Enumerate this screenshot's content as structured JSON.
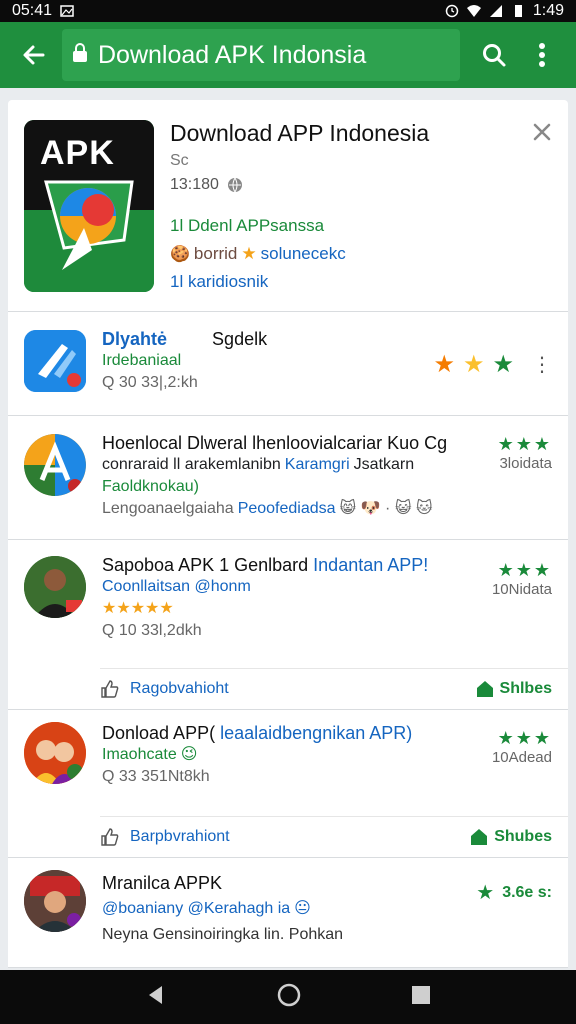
{
  "status_bar": {
    "time_left": "05:41",
    "time_right": "1:49"
  },
  "app_bar": {
    "url_text": "Download APK Indonsia"
  },
  "top_card": {
    "icon_text": "APK",
    "title": "Download APP Indonesia",
    "subtitle": "Sc",
    "meta": "13:180",
    "line1": "1l  Ddenl APPsanssa",
    "line2_a": "borrid",
    "line2_b": "solunecekc",
    "line3": "1l  karidiosnik"
  },
  "items": [
    {
      "title_a": "Dlyahtė",
      "title_b": "Sgdelk",
      "line1": "Irdebaniaal",
      "meta": "Q 30  33|,2:kh",
      "stars": [
        "orange",
        "gold",
        "green"
      ]
    },
    {
      "title": "Hoenlocal Dlweral lhenloovialcariar Kuo Cg",
      "line1_a": "conraraid ll arakemlanibn",
      "line1_b": "Karamgri",
      "line1_c": "Jsatkarn",
      "line2": "Faoldknokau)",
      "line3": "Lengoanaelgaiaha",
      "line3_b": "Peoofediadsa",
      "stars": "★★★",
      "count": "3loidata",
      "emoji": "😸 🐶 · 😺 🐱"
    },
    {
      "title_a": "Sapoboa APK  1 Genlbard",
      "title_b": "Indantan APP!",
      "line1": "Coonllaitsan @honm",
      "line2": "★★★★★",
      "meta": "Q 10  33l,2dkh",
      "stars": "★★★",
      "count": "10Nidata",
      "action_left": "Ragobvahioht",
      "action_right": "Shlbes"
    },
    {
      "title_a": "Donload APP(",
      "title_b": "leaalaidbengnikan APR)",
      "line1": "Imaohcate",
      "meta": "Q 33  351Nt8kh",
      "stars": "★★★",
      "count": "10Adead",
      "action_left": "Barpbvrahiont",
      "action_right": "Shubes"
    },
    {
      "title": "Mranilca APPK",
      "line1": "@boaniany @Kerahagh ia",
      "line2": "Neyna Gensinoiringka lin. Pohkan",
      "rating": "3.6e s:"
    }
  ]
}
